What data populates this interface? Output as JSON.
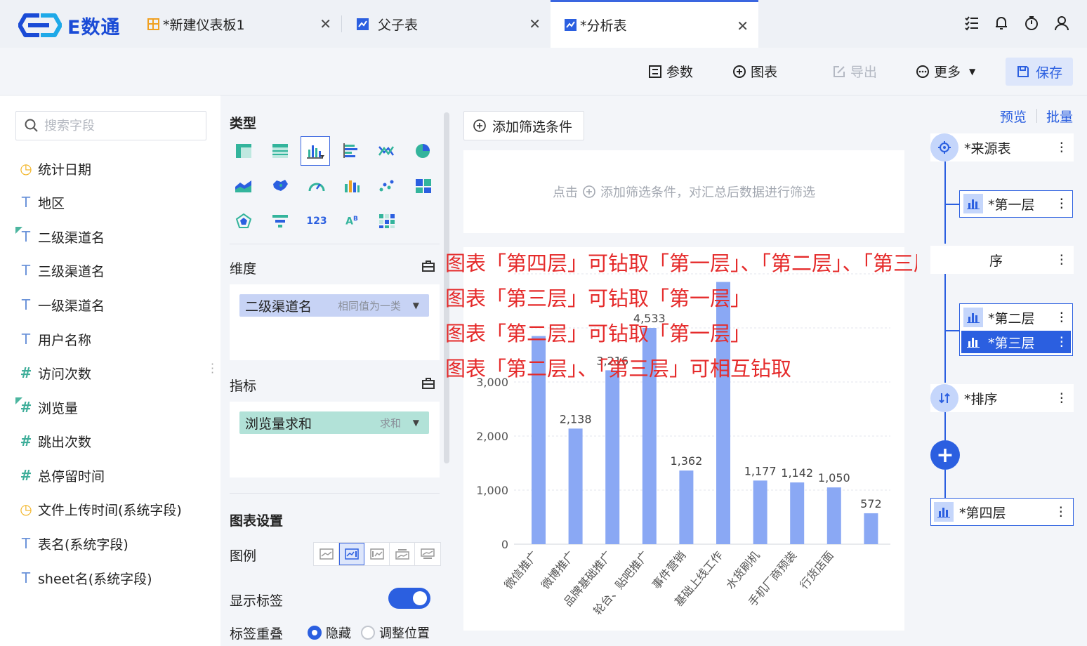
{
  "app": {
    "logo_text": "E数通"
  },
  "tabs": [
    {
      "label": "*新建仪表板1",
      "icon": "dashboard-icon"
    },
    {
      "label": "父子表",
      "icon": "analysis-table-icon"
    },
    {
      "label": "*分析表",
      "icon": "analysis-table-icon",
      "active": true
    }
  ],
  "toolbar": {
    "params_label": "参数",
    "chart_label": "图表",
    "export_label": "导出",
    "more_label": "更多",
    "save_label": "保存"
  },
  "field_panel": {
    "search_placeholder": "搜索字段",
    "fields": [
      {
        "label": "统计日期",
        "type": "date"
      },
      {
        "label": "地区",
        "type": "text"
      },
      {
        "label": "二级渠道名",
        "type": "text",
        "marked": true
      },
      {
        "label": "三级渠道名",
        "type": "text"
      },
      {
        "label": "一级渠道名",
        "type": "text"
      },
      {
        "label": "用户名称",
        "type": "text"
      },
      {
        "label": "访问次数",
        "type": "number"
      },
      {
        "label": "浏览量",
        "type": "number",
        "marked": true
      },
      {
        "label": "跳出次数",
        "type": "number"
      },
      {
        "label": "总停留时间",
        "type": "number"
      },
      {
        "label": "文件上传时间(系统字段)",
        "type": "date"
      },
      {
        "label": "表名(系统字段)",
        "type": "text"
      },
      {
        "label": "sheet名(系统字段)",
        "type": "text"
      }
    ]
  },
  "config_panel": {
    "type_title": "类型",
    "dimension_title": "维度",
    "dimension_pill": {
      "label": "二级渠道名",
      "sub": "相同值为一类"
    },
    "measure_title": "指标",
    "measure_pill": {
      "label": "浏览量求和",
      "sub": "求和"
    },
    "chart_settings_title": "图表设置",
    "legend_label": "图例",
    "show_label_label": "显示标签",
    "overlap_label": "标签重叠",
    "radio_hide": "隐藏",
    "radio_adjust": "调整位置"
  },
  "filter": {
    "add_button": "添加筛选条件",
    "hint_prefix": "点击",
    "hint_suffix": "添加筛选条件，对汇总后数据进行筛选"
  },
  "annotations": [
    "图表「第四层」可钻取「第一层」、「第二层」、「第三层」",
    "图表「第三层」可钻取「第一层」",
    "图表「第二层」可钻取「第一层」",
    "图表「第二层」、「第三层」可相互钻取"
  ],
  "chart_data": {
    "type": "bar",
    "categories": [
      "微信推广",
      "微博推广",
      "品牌基础推广",
      "轮台、贴吧推广",
      "事件营销",
      "基础上线工作",
      "水货刷机",
      "手机厂商预装",
      "行货店面"
    ],
    "values": [
      3850,
      2138,
      3216,
      4000,
      1362,
      4850,
      1177,
      1142,
      1050,
      572
    ],
    "visible_labels": [
      "",
      "2,138",
      "3,216",
      "4,533",
      "1,362",
      "",
      "1,177",
      "1,142",
      "1,050",
      "572"
    ],
    "y_ticks": [
      "0",
      "1,000",
      "2,000",
      "3,000"
    ],
    "ylim": [
      0,
      5000
    ],
    "color": "#8aa8f4",
    "grid": true
  },
  "flow": {
    "preview_label": "预览",
    "batch_label": "批量",
    "source_label": "*来源表",
    "layer1_label": "*第一层",
    "sort_partial_label": "序",
    "layer2_label": "*第二层",
    "layer3_label": "*第三层",
    "sort_label": "*排序",
    "layer4_label": "*第四层"
  }
}
